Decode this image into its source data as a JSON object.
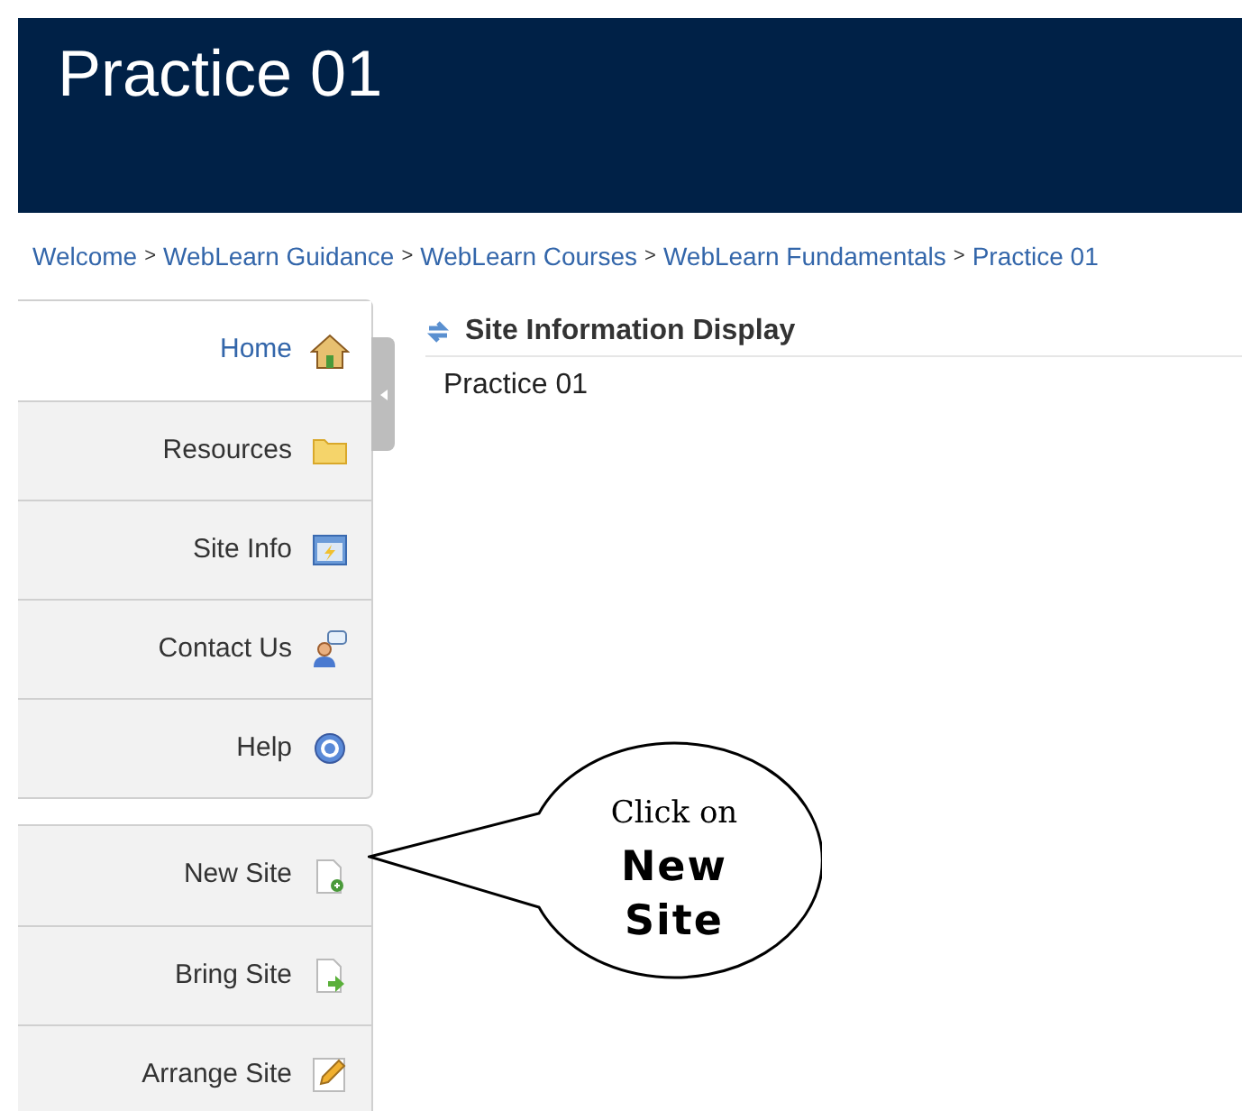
{
  "header": {
    "title": "Practice 01"
  },
  "breadcrumb": {
    "separator": ">",
    "items": [
      "Welcome",
      "WebLearn Guidance",
      "WebLearn Courses",
      "WebLearn Fundamentals",
      "Practice 01"
    ]
  },
  "sidebar": {
    "groups": [
      {
        "items": [
          {
            "label": "Home",
            "kind": "home",
            "selected": true
          },
          {
            "label": "Resources",
            "kind": "folder",
            "selected": false
          },
          {
            "label": "Site Info",
            "kind": "info",
            "selected": false
          },
          {
            "label": "Contact Us",
            "kind": "contact",
            "selected": false
          },
          {
            "label": "Help",
            "kind": "help",
            "selected": false
          }
        ]
      },
      {
        "items": [
          {
            "label": "New Site",
            "kind": "new",
            "selected": false
          },
          {
            "label": "Bring Site",
            "kind": "bring",
            "selected": false
          },
          {
            "label": "Arrange Site",
            "kind": "arrange",
            "selected": false
          }
        ]
      }
    ]
  },
  "content": {
    "title": "Site Information Display",
    "text": "Practice 01"
  },
  "callout": {
    "line1": "Click on",
    "line2": "New",
    "line3": "Site"
  }
}
